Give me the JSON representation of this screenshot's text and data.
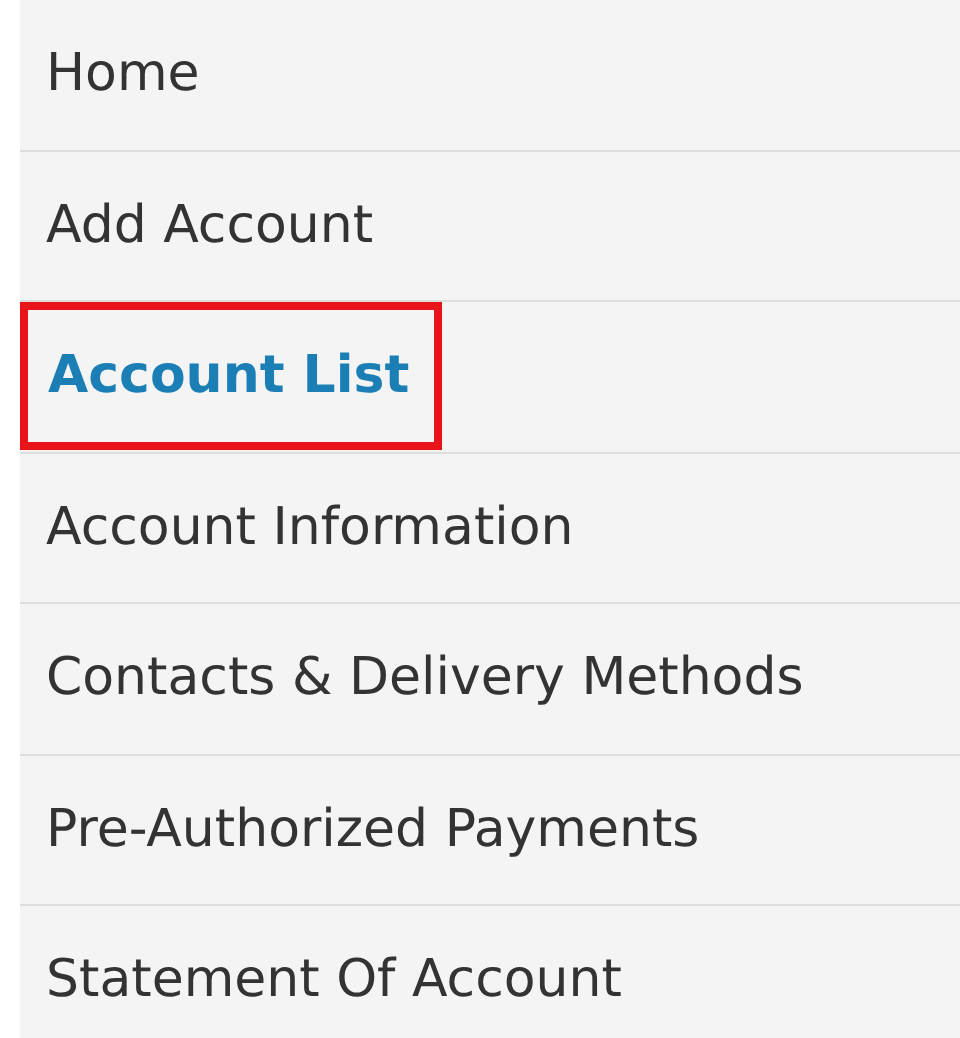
{
  "menu": {
    "items": [
      {
        "label": "Home",
        "selected": false,
        "outlined": false
      },
      {
        "label": "Add Account",
        "selected": false,
        "outlined": false
      },
      {
        "label": "Account List",
        "selected": true,
        "outlined": true
      },
      {
        "label": "Account Information",
        "selected": false,
        "outlined": false
      },
      {
        "label": "Contacts & Delivery Methods",
        "selected": false,
        "outlined": false
      },
      {
        "label": "Pre-Authorized Payments",
        "selected": false,
        "outlined": false
      },
      {
        "label": "Statement Of Account",
        "selected": false,
        "outlined": false
      }
    ]
  }
}
